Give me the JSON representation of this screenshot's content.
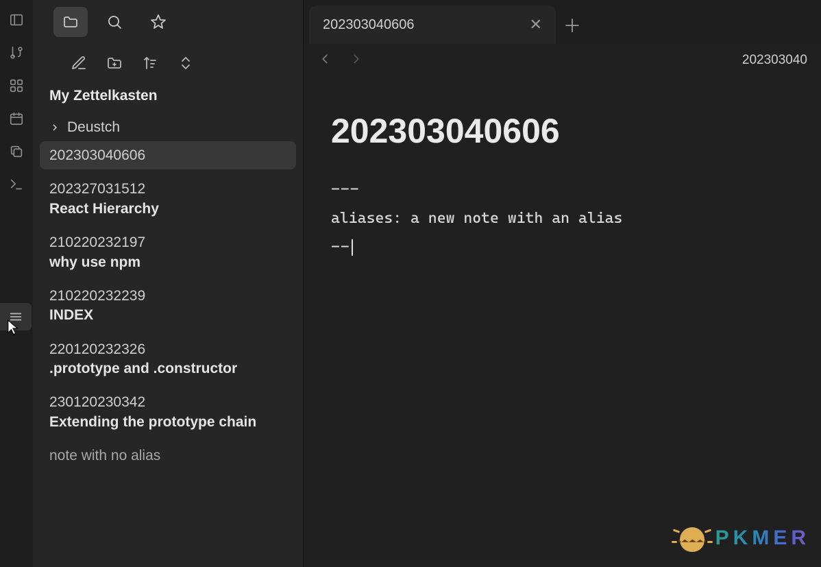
{
  "ribbon": {
    "icons": [
      "files-icon",
      "graph-icon",
      "apps-icon",
      "calendar-icon",
      "copy-icon",
      "terminal-icon"
    ]
  },
  "left_tabs": {
    "folder_label": "Files",
    "search_label": "Search",
    "star_label": "Bookmarks"
  },
  "vault": {
    "title": "My Zettelkasten"
  },
  "tree": {
    "folders": [
      {
        "name": "Deustch"
      }
    ],
    "files": [
      {
        "id": "202303040606",
        "title": "",
        "active": true
      },
      {
        "id": "202327031512",
        "title": "React Hierarchy"
      },
      {
        "id": "210220232197",
        "title": "why use npm"
      },
      {
        "id": "210220232239",
        "title": "INDEX"
      },
      {
        "id": "220120232326",
        "title": ".prototype and .constructor"
      },
      {
        "id": "230120230342",
        "title": "Extending the prototype chain"
      },
      {
        "id": "note with no alias",
        "title": ""
      }
    ]
  },
  "tabs": {
    "open": [
      {
        "label": "202303040606"
      }
    ]
  },
  "breadcrumb": "202303040",
  "note": {
    "title": "202303040606",
    "lines": {
      "l0": "---",
      "l1": "aliases: a new note with an alias",
      "l2": "--"
    }
  },
  "watermark": {
    "text": "PKMER"
  }
}
